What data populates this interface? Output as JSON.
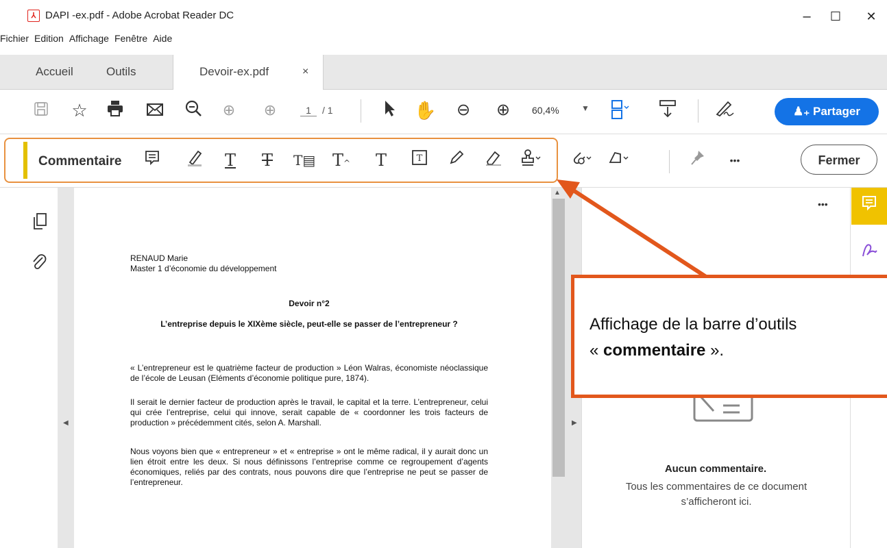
{
  "window": {
    "title": "DAPI -ex.pdf - Adobe Acrobat Reader DC",
    "controls": {
      "minimize": "–",
      "maximize": "☐",
      "close": "✕"
    }
  },
  "menu": [
    "Fichier",
    "Edition",
    "Affichage",
    "Fenêtre",
    "Aide"
  ],
  "tabs": {
    "home": "Accueil",
    "tools": "Outils",
    "document": "Devoir-ex.pdf",
    "close": "×"
  },
  "toolbar": {
    "page_current": "1",
    "page_total": "/ 1",
    "zoom": "60,4%",
    "share_label": "Partager"
  },
  "comment_toolbar": {
    "label": "Commentaire",
    "close_label": "Fermer",
    "more": "•••"
  },
  "document": {
    "author": "RENAUD Marie",
    "course": "Master 1 d’économie du développement",
    "heading": "Devoir n°2",
    "subtitle": "L’entreprise depuis le XIXème siècle, peut-elle se passer de l’entrepreneur ?",
    "paragraphs": [
      "« L’entrepreneur est le quatrième facteur de production » Léon Walras, économiste néoclassique de l’école de Leusan (Eléments d’économie politique pure, 1874).",
      "Il serait le dernier facteur de production après le travail, le capital et la terre. L’entrepreneur, celui qui crée l’entreprise, celui qui innove, serait capable de « coordonner les trois facteurs de production » précédemment cités, selon A. Marshall.",
      "Nous voyons bien que « entrepreneur » et « entreprise » ont le même radical, il y aurait donc un lien étroit entre les deux. Si nous définissons l’entreprise comme ce regroupement d’agents économiques, reliés par des contrats, nous pouvons dire que l’entreprise ne peut se passer de l’entrepreneur."
    ]
  },
  "comments_panel": {
    "more": "•••",
    "empty_title": "Aucun commentaire.",
    "empty_text": "Tous les commentaires de ce document s’afficheront ici."
  },
  "callout": {
    "line1": "Affichage de la barre d’outils",
    "open_quote": "« ",
    "keyword": "commentaire",
    "close_quote": " »."
  },
  "colors": {
    "accent": "#1473e6",
    "highlight": "#f0c200",
    "callout": "#e2571c",
    "frame": "#e8913f"
  }
}
